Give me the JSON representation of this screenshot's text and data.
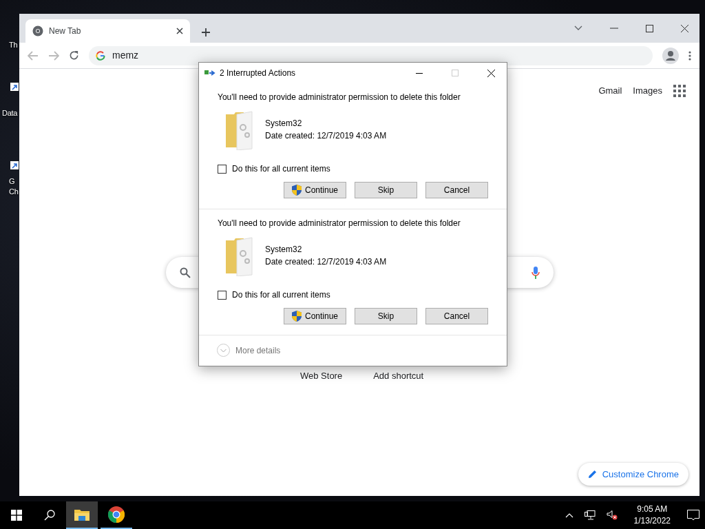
{
  "desktop": {
    "icons": [
      {
        "lines": [
          "Th"
        ]
      },
      {
        "lines": [
          "Data"
        ]
      },
      {
        "lines": [
          "G",
          "Ch"
        ]
      }
    ]
  },
  "browser": {
    "tab": {
      "title": "New Tab",
      "selected": true
    },
    "address": "memz",
    "top_links": [
      "Gmail",
      "Images"
    ],
    "shortcuts": [
      "Web Store",
      "Add shortcut"
    ],
    "customize": "Customize Chrome"
  },
  "dialog": {
    "title": "2 Interrupted Actions",
    "items": [
      {
        "message": "You'll need to provide administrator permission to delete this folder",
        "name": "System32",
        "date": "Date created: 12/7/2019 4:03 AM",
        "option": {
          "label": "Do this for all current items",
          "checked": false
        },
        "buttons": [
          {
            "label": "Continue",
            "kind": "shield"
          },
          {
            "label": "Skip",
            "kind": "plain"
          },
          {
            "label": "Cancel",
            "kind": "plain"
          }
        ]
      },
      {
        "message": "You'll need to provide administrator permission to delete this folder",
        "name": "System32",
        "date": "Date created: 12/7/2019 4:03 AM",
        "option": {
          "label": "Do this for all current items",
          "checked": false
        },
        "buttons": [
          {
            "label": "Continue",
            "kind": "shield"
          },
          {
            "label": "Skip",
            "kind": "plain"
          },
          {
            "label": "Cancel",
            "kind": "plain"
          }
        ]
      }
    ],
    "more_details": "More details"
  },
  "taskbar": {
    "apps": [
      {
        "kind": "explorer",
        "active": true
      },
      {
        "kind": "chrome",
        "active": false
      }
    ],
    "time": "9:05 AM",
    "date": "1/13/2022"
  }
}
